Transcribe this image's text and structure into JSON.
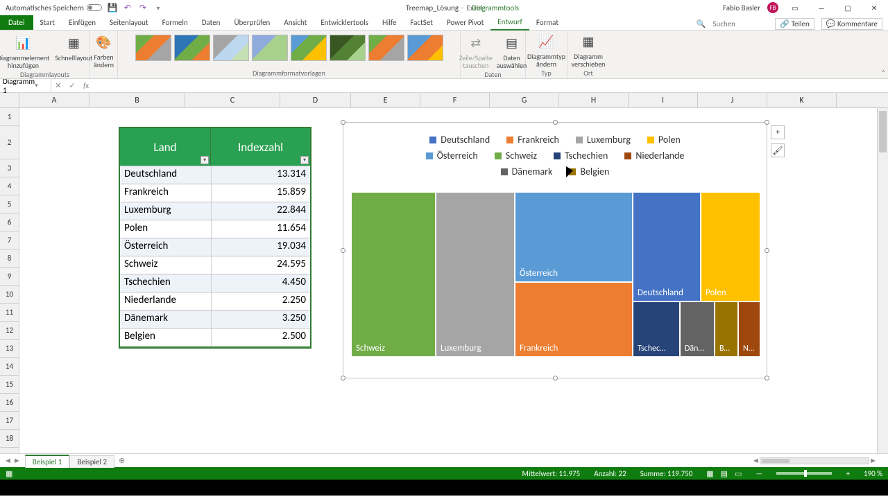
{
  "titlebar": {
    "autosave": "Automatisches Speichern",
    "doc_title": "Treemap_Lösung",
    "app_name": "Excel",
    "tool_context": "Diagrammtools",
    "user": "Fabio Basler",
    "user_initials": "FB"
  },
  "tabs": {
    "file": "Datei",
    "items": [
      "Start",
      "Einfügen",
      "Seitenlayout",
      "Formeln",
      "Daten",
      "Überprüfen",
      "Ansicht",
      "Entwicklertools",
      "Hilfe",
      "FactSet",
      "Power Pivot",
      "Entwurf",
      "Format"
    ],
    "active": "Entwurf",
    "search_placeholder": "Suchen",
    "share": "Teilen",
    "comments": "Kommentare"
  },
  "ribbon": {
    "add_element": "Diagrammelement hinzufügen",
    "quick_layout": "Schnelllayout",
    "change_colors": "Farben ändern",
    "group_layouts": "Diagrammlayouts",
    "group_styles": "Diagrammformatvorlagen",
    "switch_rowcol": "Zeile/Spalte tauschen",
    "select_data": "Daten auswählen",
    "group_data": "Daten",
    "change_type": "Diagrammtyp ändern",
    "group_type": "Typ",
    "move_chart": "Diagramm verschieben",
    "group_location": "Ort"
  },
  "namebox": "Diagramm 1",
  "table": {
    "col1": "Land",
    "col2": "Indexzahl",
    "rows": [
      {
        "land": "Deutschland",
        "val": "13.314"
      },
      {
        "land": "Frankreich",
        "val": "15.859"
      },
      {
        "land": "Luxemburg",
        "val": "22.844"
      },
      {
        "land": "Polen",
        "val": "11.654"
      },
      {
        "land": "Österreich",
        "val": "19.034"
      },
      {
        "land": "Schweiz",
        "val": "24.595"
      },
      {
        "land": "Tschechien",
        "val": "4.450"
      },
      {
        "land": "Niederlande",
        "val": "2.250"
      },
      {
        "land": "Dänemark",
        "val": "3.250"
      },
      {
        "land": "Belgien",
        "val": "2.500"
      }
    ]
  },
  "chart_data": {
    "type": "treemap",
    "series": [
      {
        "name": "Deutschland",
        "value": 13314,
        "color": "#4472c4"
      },
      {
        "name": "Frankreich",
        "value": 15859,
        "color": "#ed7d31"
      },
      {
        "name": "Luxemburg",
        "value": 22844,
        "color": "#a5a5a5"
      },
      {
        "name": "Polen",
        "value": 11654,
        "color": "#ffc000"
      },
      {
        "name": "Österreich",
        "value": 19034,
        "color": "#5b9bd5"
      },
      {
        "name": "Schweiz",
        "value": 24595,
        "color": "#70ad47"
      },
      {
        "name": "Tschechien",
        "value": 4450,
        "color": "#264478"
      },
      {
        "name": "Niederlande",
        "value": 2250,
        "color": "#9e480e"
      },
      {
        "name": "Dänemark",
        "value": 3250,
        "color": "#636363"
      },
      {
        "name": "Belgien",
        "value": 2500,
        "color": "#997300"
      }
    ],
    "tile_labels": {
      "ch": "Schweiz",
      "lu": "Luxemburg",
      "at": "Österreich",
      "fr": "Frankreich",
      "de": "Deutschland",
      "pl": "Polen",
      "cz": "Tschec…",
      "dk": "Dän…",
      "be": "B…",
      "nl": "N…"
    }
  },
  "cols": [
    "A",
    "B",
    "C",
    "D",
    "E",
    "F",
    "G",
    "H",
    "I",
    "J",
    "K"
  ],
  "rows": [
    "1",
    "2",
    "3",
    "4",
    "5",
    "6",
    "7",
    "8",
    "9",
    "10",
    "11",
    "12",
    "13",
    "14",
    "15",
    "16",
    "17",
    "18"
  ],
  "sheets": {
    "active": "Beispiel 1",
    "other": "Beispiel 2"
  },
  "status": {
    "avg_label": "Mittelwert:",
    "avg": "11.975",
    "count_label": "Anzahl:",
    "count": "22",
    "sum_label": "Summe:",
    "sum": "119.750",
    "zoom": "190 %"
  }
}
